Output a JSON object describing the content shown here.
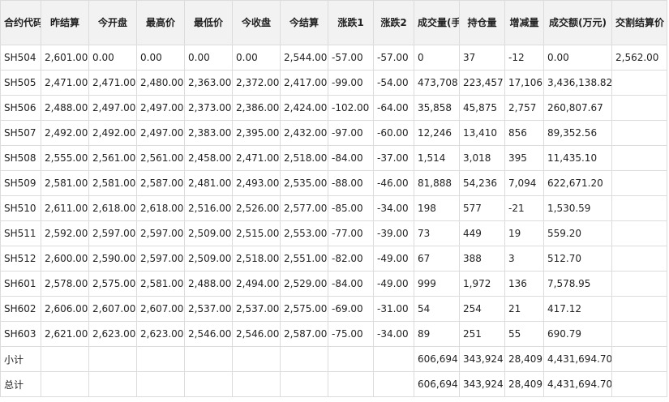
{
  "columns": [
    "合约代码",
    "昨结算",
    "今开盘",
    "最高价",
    "最低价",
    "今收盘",
    "今结算",
    "涨跌1",
    "涨跌2",
    "成交量(手)",
    "持仓量",
    "增减量",
    "成交额(万元)",
    "交割结算价"
  ],
  "rows": [
    [
      "SH504",
      "2,601.00",
      "0.00",
      "0.00",
      "0.00",
      "0.00",
      "2,544.00",
      "-57.00",
      "-57.00",
      "0",
      "37",
      "-12",
      "0.00",
      "2,562.00"
    ],
    [
      "SH505",
      "2,471.00",
      "2,471.00",
      "2,480.00",
      "2,363.00",
      "2,372.00",
      "2,417.00",
      "-99.00",
      "-54.00",
      "473,708",
      "223,457",
      "17,106",
      "3,436,138.82",
      ""
    ],
    [
      "SH506",
      "2,488.00",
      "2,497.00",
      "2,497.00",
      "2,373.00",
      "2,386.00",
      "2,424.00",
      "-102.00",
      "-64.00",
      "35,858",
      "45,875",
      "2,757",
      "260,807.67",
      ""
    ],
    [
      "SH507",
      "2,492.00",
      "2,492.00",
      "2,497.00",
      "2,383.00",
      "2,395.00",
      "2,432.00",
      "-97.00",
      "-60.00",
      "12,246",
      "13,410",
      "856",
      "89,352.56",
      ""
    ],
    [
      "SH508",
      "2,555.00",
      "2,561.00",
      "2,561.00",
      "2,458.00",
      "2,471.00",
      "2,518.00",
      "-84.00",
      "-37.00",
      "1,514",
      "3,018",
      "395",
      "11,435.10",
      ""
    ],
    [
      "SH509",
      "2,581.00",
      "2,581.00",
      "2,587.00",
      "2,481.00",
      "2,493.00",
      "2,535.00",
      "-88.00",
      "-46.00",
      "81,888",
      "54,236",
      "7,094",
      "622,671.20",
      ""
    ],
    [
      "SH510",
      "2,611.00",
      "2,618.00",
      "2,618.00",
      "2,516.00",
      "2,526.00",
      "2,577.00",
      "-85.00",
      "-34.00",
      "198",
      "577",
      "-21",
      "1,530.59",
      ""
    ],
    [
      "SH511",
      "2,592.00",
      "2,597.00",
      "2,597.00",
      "2,509.00",
      "2,515.00",
      "2,553.00",
      "-77.00",
      "-39.00",
      "73",
      "449",
      "19",
      "559.20",
      ""
    ],
    [
      "SH512",
      "2,600.00",
      "2,590.00",
      "2,597.00",
      "2,509.00",
      "2,518.00",
      "2,551.00",
      "-82.00",
      "-49.00",
      "67",
      "388",
      "3",
      "512.70",
      ""
    ],
    [
      "SH601",
      "2,578.00",
      "2,575.00",
      "2,581.00",
      "2,488.00",
      "2,494.00",
      "2,529.00",
      "-84.00",
      "-49.00",
      "999",
      "1,972",
      "136",
      "7,578.95",
      ""
    ],
    [
      "SH602",
      "2,606.00",
      "2,607.00",
      "2,607.00",
      "2,537.00",
      "2,537.00",
      "2,575.00",
      "-69.00",
      "-31.00",
      "54",
      "254",
      "21",
      "417.12",
      ""
    ],
    [
      "SH603",
      "2,621.00",
      "2,623.00",
      "2,623.00",
      "2,546.00",
      "2,546.00",
      "2,587.00",
      "-75.00",
      "-34.00",
      "89",
      "251",
      "55",
      "690.79",
      ""
    ],
    [
      "小计",
      "",
      "",
      "",
      "",
      "",
      "",
      "",
      "",
      "606,694",
      "343,924",
      "28,409",
      "4,431,694.70",
      ""
    ],
    [
      "总计",
      "",
      "",
      "",
      "",
      "",
      "",
      "",
      "",
      "606,694",
      "343,924",
      "28,409",
      "4,431,694.70",
      ""
    ]
  ]
}
